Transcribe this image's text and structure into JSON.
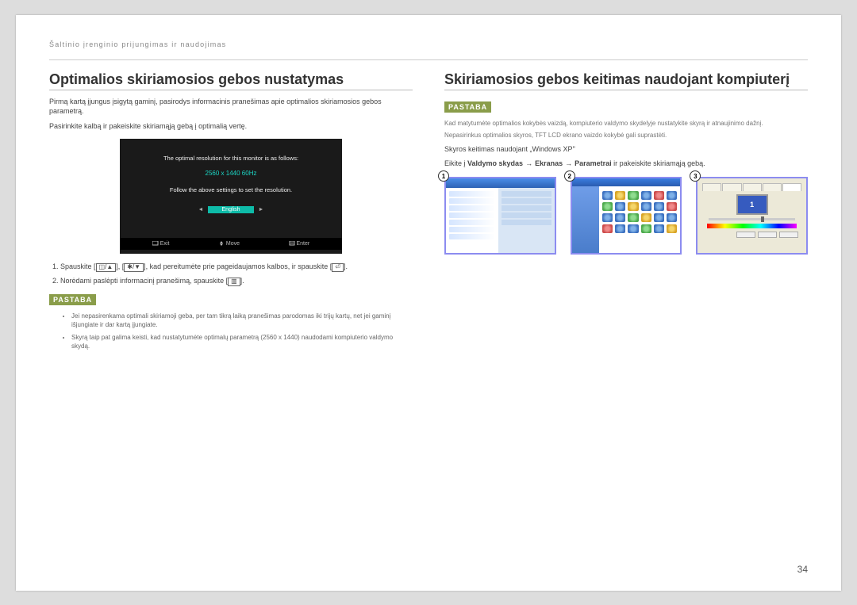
{
  "header": "Šaltinio įrenginio prijungimas ir naudojimas",
  "page_number": "34",
  "left": {
    "title": "Optimalios skiriamosios gebos nustatymas",
    "intro1": "Pirmą kartą įjungus įsigytą gaminį, pasirodys informacinis pranešimas apie optimalios skiriamosios gebos parametrą.",
    "intro2": "Pasirinkite kalbą ir pakeiskite skiriamąją gebą į optimalią vertę.",
    "osd": {
      "line1": "The optimal resolution for this monitor is as follows:",
      "resolution": "2560 x 1440  60Hz",
      "line2": "Follow the above settings to set the resolution.",
      "lang": "English",
      "exit": "Exit",
      "move": "Move",
      "enter": "Enter"
    },
    "step1_pre": "Spauskite [",
    "step1_mid": "], [",
    "step1_post": "], kad pereitumėte prie pageidaujamos kalbos, ir spauskite [",
    "step1_end": "].",
    "step2_pre": "Norėdami paslėpti informacinį pranešimą, spauskite [",
    "step2_end": "].",
    "note_label": "PASTABA",
    "note1": "Jei nepasirenkama optimali skiriamoji geba, per tam tikrą laiką pranešimas parodomas iki trijų kartų, net jei gaminį išjungiate ir dar kartą įjungiate.",
    "note2": "Skyrą taip pat galima keisti, kad nustatytumėte optimalų parametrą (2560 x 1440) naudodami kompiuterio valdymo skydą."
  },
  "right": {
    "title": "Skiriamosios gebos keitimas naudojant kompiuterį",
    "note_label": "PASTABA",
    "note_body": "Kad matytumėte optimalios kokybės vaizdą, kompiuterio valdymo skydelyje nustatykite skyrą ir atnaujinimo dažnį.",
    "note_sub": "Nepasirinkus optimalios skyros, TFT LCD ekrano vaizdo kokybė gali suprastėti.",
    "winxp": "Skyros keitimas naudojant „Windows XP\"",
    "path_pre": "Eikite į ",
    "path_1": "Valdymo skydas",
    "path_2": "Ekranas",
    "path_3": "Parametrai",
    "path_post": " ir pakeiskite skiriamąją gebą.",
    "s1": "1",
    "s2": "2",
    "s3": "3",
    "t3_num": "1"
  }
}
